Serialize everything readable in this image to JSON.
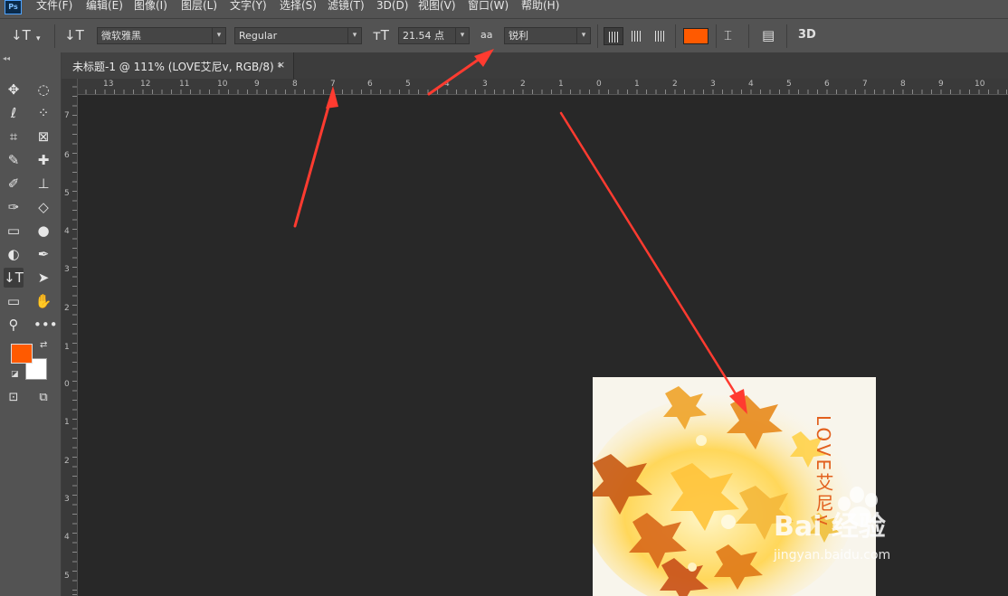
{
  "app": {
    "logo": "Ps"
  },
  "menu": [
    "文件(F)",
    "编辑(E)",
    "图像(I)",
    "图层(L)",
    "文字(Y)",
    "选择(S)",
    "滤镜(T)",
    "3D(D)",
    "视图(V)",
    "窗口(W)",
    "帮助(H)"
  ],
  "options": {
    "font_family": "微软雅黑",
    "font_style": "Regular",
    "font_size": "21.54 点",
    "aa_label": "aa",
    "antialias": "锐利",
    "text_color": "#ff5a00",
    "three_d": "3D"
  },
  "document": {
    "tab_title": "未标题-1 @ 111% (LOVE艾尼v, RGB/8) *",
    "close": "×"
  },
  "ruler": {
    "horizontal": [
      "13",
      "12",
      "11",
      "10",
      "9",
      "8",
      "7",
      "6",
      "5",
      "4",
      "3",
      "2",
      "1",
      "0",
      "1",
      "2",
      "3",
      "4",
      "5",
      "6",
      "7",
      "8",
      "9",
      "10"
    ],
    "vertical": [
      "7",
      "6",
      "5",
      "4",
      "3",
      "2",
      "1",
      "0",
      "1",
      "2",
      "3",
      "4",
      "5"
    ]
  },
  "colors": {
    "foreground": "#ff5a00",
    "background": "#ffffff",
    "annotation": "#ff3b30"
  },
  "artwork": {
    "text": "LOVE艾尼v"
  },
  "watermark": {
    "brand": "Bai 经验",
    "url": "jingyan.baidu.com"
  }
}
